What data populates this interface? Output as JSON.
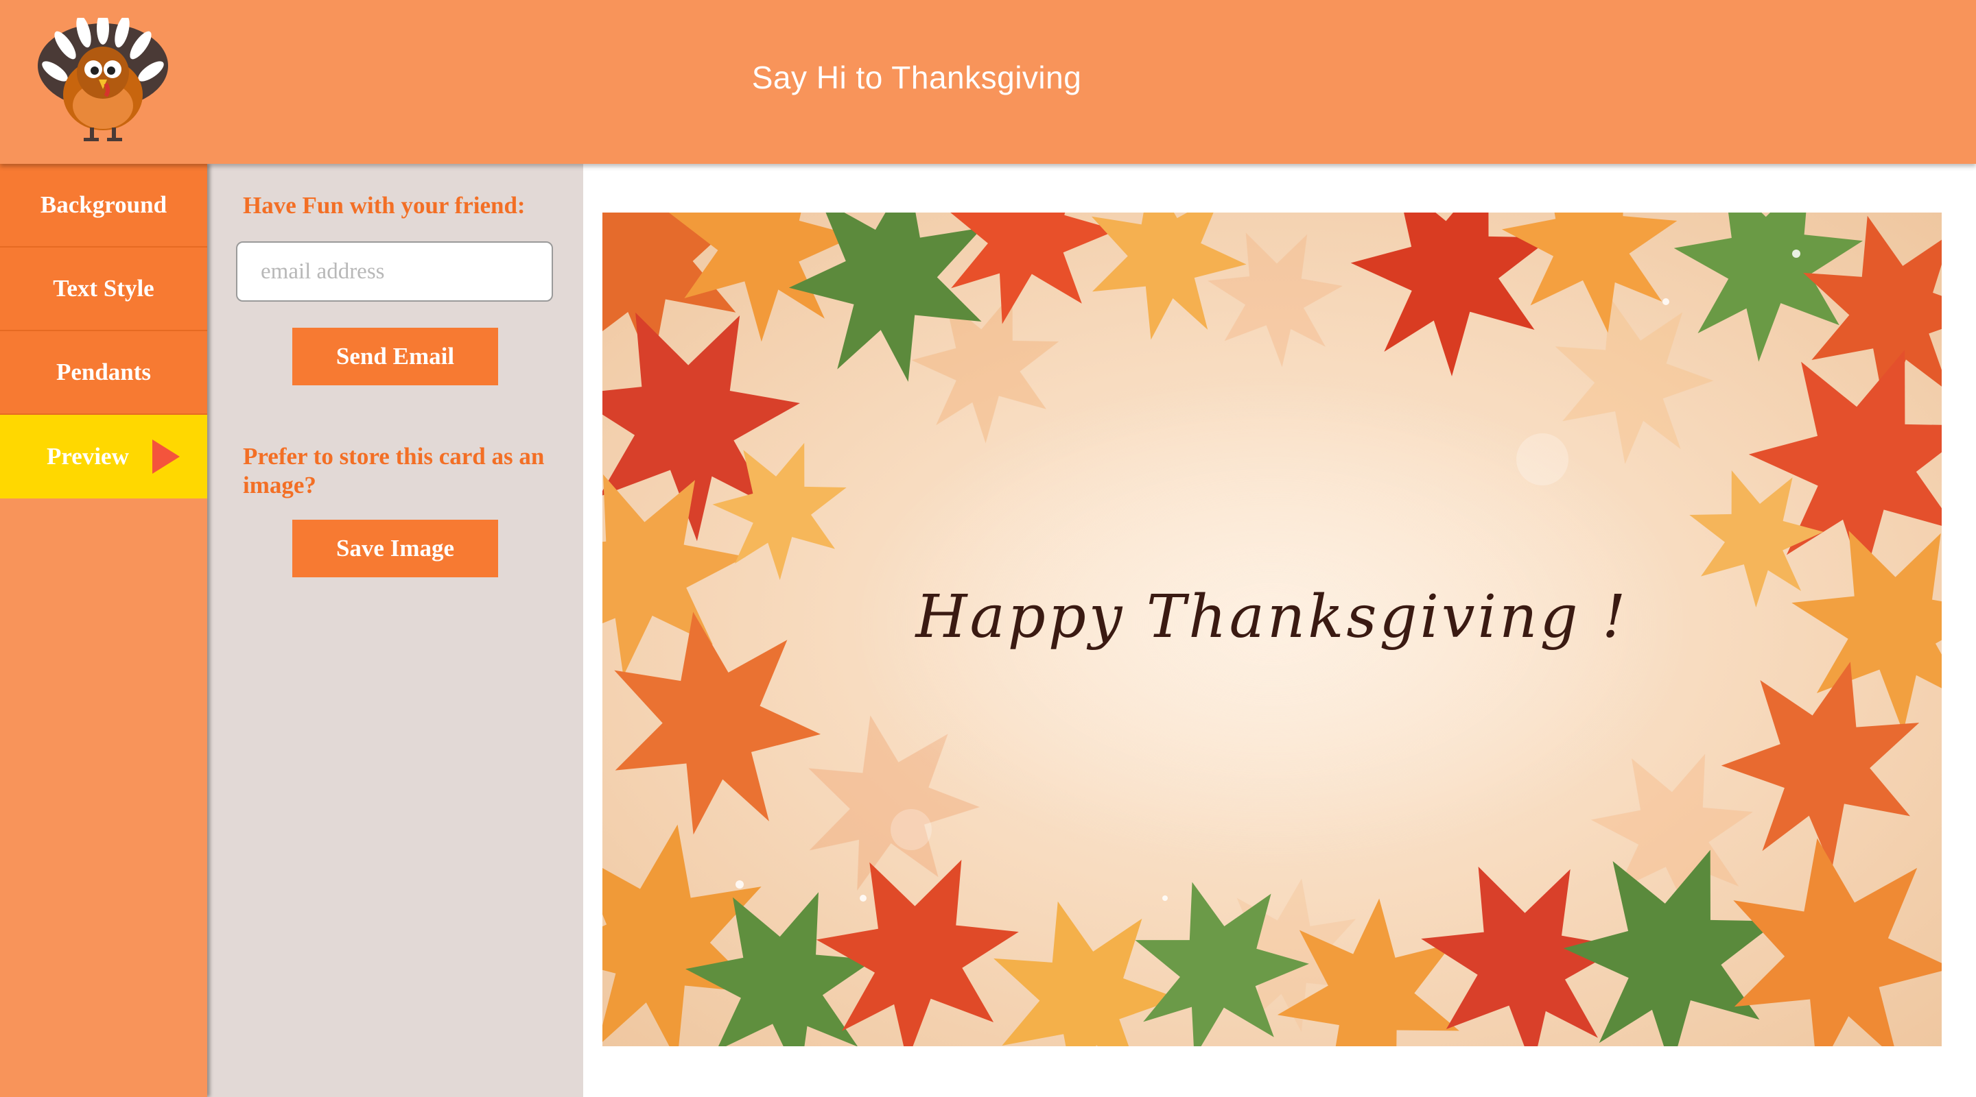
{
  "header": {
    "title": "Say Hi to Thanksgiving",
    "logo_icon": "turkey-logo-icon"
  },
  "sidebar": {
    "items": [
      {
        "label": "Background",
        "active": false
      },
      {
        "label": "Text Style",
        "active": false
      },
      {
        "label": "Pendants",
        "active": false
      },
      {
        "label": "Preview",
        "active": true,
        "icon": "play-arrow-icon"
      }
    ]
  },
  "panel": {
    "email_heading": "Have Fun with your friend:",
    "email_placeholder": "email address",
    "send_button": "Send Email",
    "save_heading": "Prefer to store this card as an image?",
    "save_button": "Save Image"
  },
  "card": {
    "message": "Happy Thanksgiving !",
    "background": "autumn maple leaves frame"
  },
  "colors": {
    "header_bg": "#f8945a",
    "nav_item_bg": "#f77a32",
    "nav_active_bg": "#ffd800",
    "panel_bg": "#e2d9d6",
    "accent_text": "#f36f25",
    "message_text": "#3a1a12"
  }
}
